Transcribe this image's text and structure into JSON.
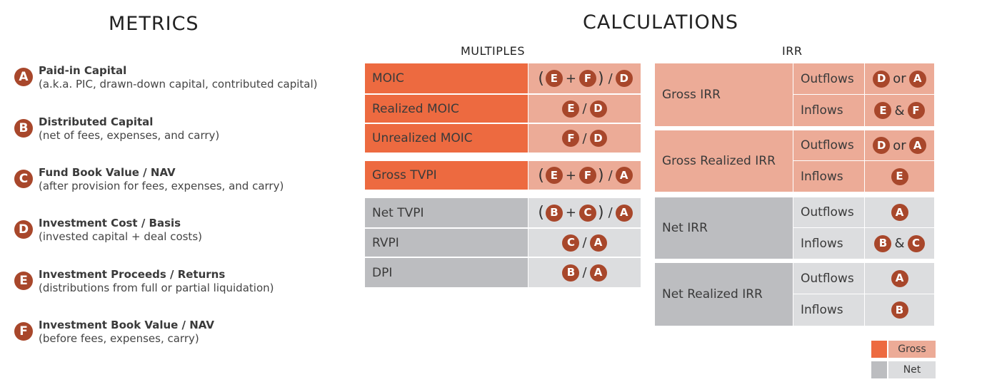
{
  "titles": {
    "metrics": "METRICS",
    "calculations": "CALCULATIONS",
    "multiples": "MULTIPLES",
    "irr": "IRR"
  },
  "metrics": [
    {
      "letter": "A",
      "name": "Paid-in Capital",
      "desc": "(a.k.a. PIC, drawn-down capital, contributed capital)"
    },
    {
      "letter": "B",
      "name": "Distributed Capital",
      "desc": "(net of fees, expenses, and carry)"
    },
    {
      "letter": "C",
      "name": "Fund Book Value / NAV",
      "desc": "(after provision for fees, expenses, and carry)"
    },
    {
      "letter": "D",
      "name": "Investment Cost / Basis",
      "desc": "(invested capital + deal costs)"
    },
    {
      "letter": "E",
      "name": "Investment Proceeds / Returns",
      "desc": "(distributions from full or partial liquidation)"
    },
    {
      "letter": "F",
      "name": "Investment Book Value / NAV",
      "desc": "(before fees, expenses, carry)"
    }
  ],
  "multiples": [
    {
      "label": "MOIC",
      "type": "gross",
      "formula": [
        "(",
        "E",
        "+",
        "F",
        ")",
        "/",
        "D"
      ]
    },
    {
      "label": "Realized MOIC",
      "type": "gross",
      "formula": [
        "E",
        "/",
        "D"
      ]
    },
    {
      "label": "Unrealized MOIC",
      "type": "gross",
      "formula": [
        "F",
        "/",
        "D"
      ]
    },
    {
      "label": "Gross TVPI",
      "type": "gross",
      "formula": [
        "(",
        "E",
        "+",
        "F",
        ")",
        "/",
        "A"
      ]
    },
    {
      "label": "Net TVPI",
      "type": "net",
      "formula": [
        "(",
        "B",
        "+",
        "C",
        ")",
        "/",
        "A"
      ]
    },
    {
      "label": "RVPI",
      "type": "net",
      "formula": [
        "C",
        "/",
        "A"
      ]
    },
    {
      "label": "DPI",
      "type": "net",
      "formula": [
        "B",
        "/",
        "A"
      ]
    }
  ],
  "irr": [
    {
      "label": "Gross IRR",
      "type": "gross",
      "rows": [
        {
          "flow": "Outflows",
          "formula": [
            "D",
            "or",
            "A"
          ]
        },
        {
          "flow": "Inflows",
          "formula": [
            "E",
            "&",
            "F"
          ]
        }
      ]
    },
    {
      "label": "Gross Realized IRR",
      "type": "gross",
      "rows": [
        {
          "flow": "Outflows",
          "formula": [
            "D",
            "or",
            "A"
          ]
        },
        {
          "flow": "Inflows",
          "formula": [
            "E"
          ]
        }
      ]
    },
    {
      "label": "Net IRR",
      "type": "net",
      "rows": [
        {
          "flow": "Outflows",
          "formula": [
            "A"
          ]
        },
        {
          "flow": "Inflows",
          "formula": [
            "B",
            "&",
            "C"
          ]
        }
      ]
    },
    {
      "label": "Net Realized IRR",
      "type": "net",
      "rows": [
        {
          "flow": "Outflows",
          "formula": [
            "A"
          ]
        },
        {
          "flow": "Inflows",
          "formula": [
            "B"
          ]
        }
      ]
    }
  ],
  "legend": [
    {
      "label": "Gross",
      "type": "gross"
    },
    {
      "label": "Net",
      "type": "net"
    }
  ],
  "colors": {
    "gross_dark": "#ed6a40",
    "gross_light": "#ecab97",
    "net_dark": "#bcbdc0",
    "net_light": "#dcdddf",
    "badge": "#a8472b"
  }
}
